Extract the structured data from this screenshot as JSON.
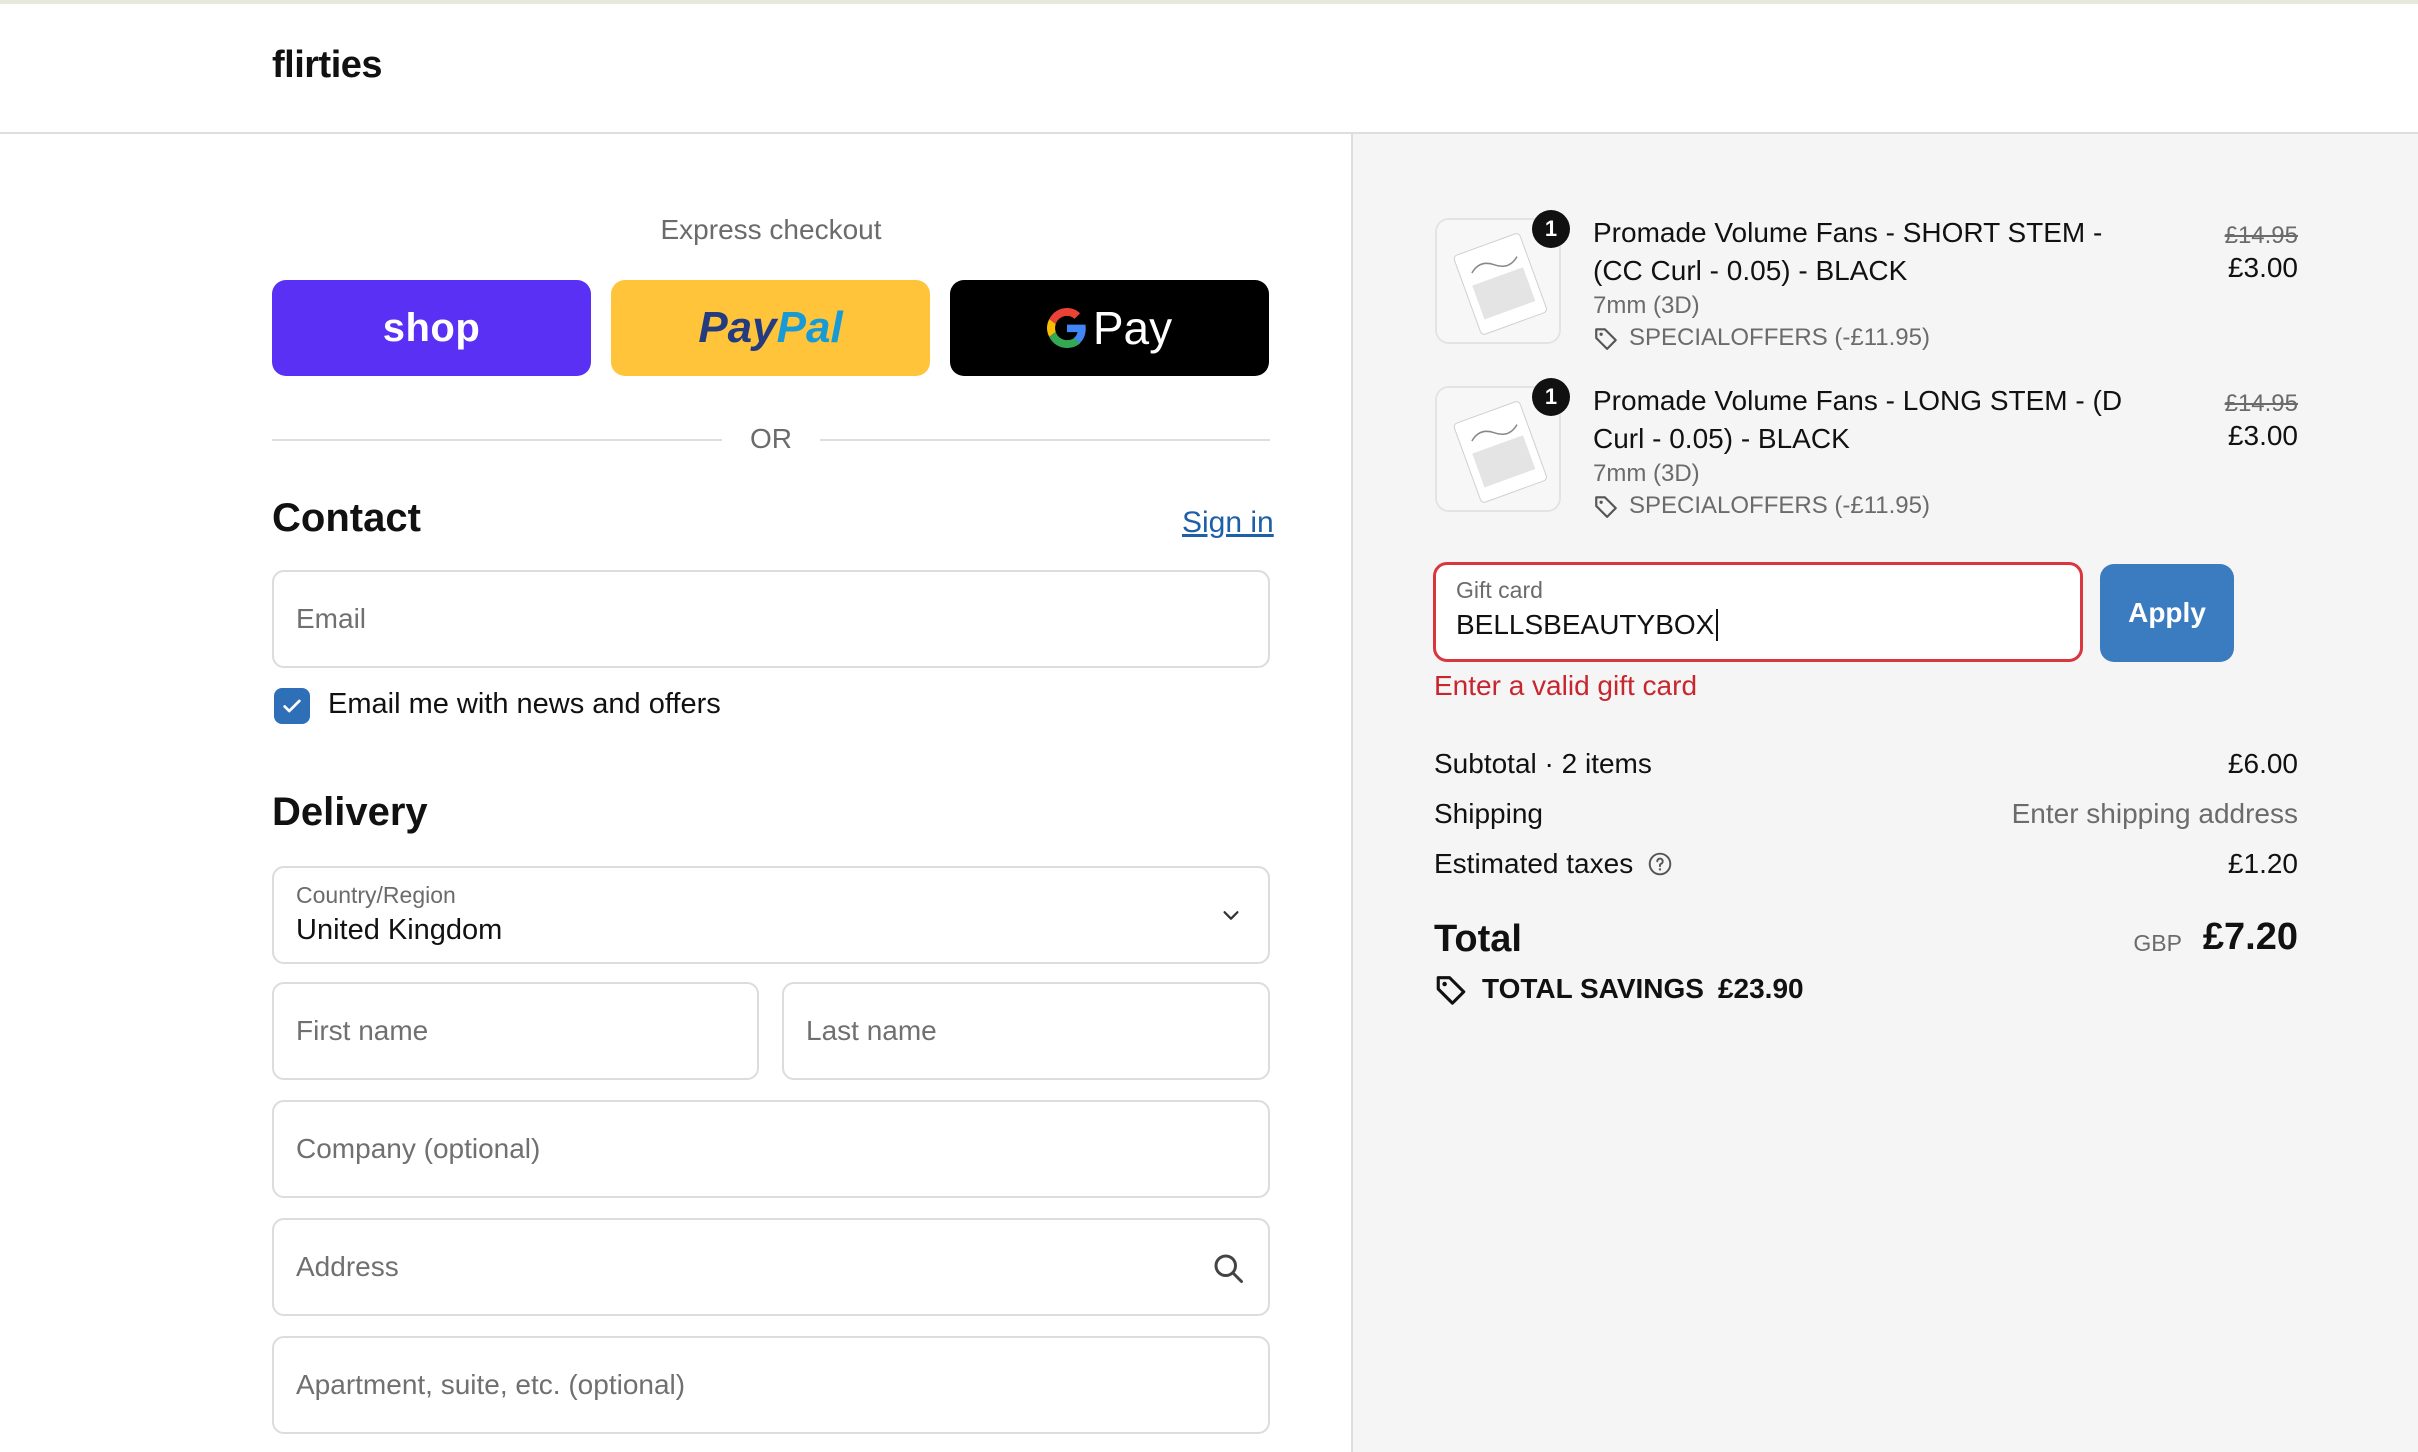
{
  "header": {
    "logo": "flirties"
  },
  "express": {
    "title": "Express checkout",
    "shop_label": "shop",
    "paypal_pay": "Pay",
    "paypal_pal": "Pal",
    "gpay_label": "Pay",
    "or_label": "OR"
  },
  "contact": {
    "heading": "Contact",
    "sign_in": "Sign in",
    "email_placeholder": "Email",
    "news_label": "Email me with news and offers"
  },
  "delivery": {
    "heading": "Delivery",
    "country_label": "Country/Region",
    "country_value": "United Kingdom",
    "first_name_placeholder": "First name",
    "last_name_placeholder": "Last name",
    "company_placeholder": "Company (optional)",
    "address_placeholder": "Address",
    "apartment_placeholder": "Apartment, suite, etc. (optional)"
  },
  "cart": {
    "items": [
      {
        "qty": "1",
        "title": "Promade Volume Fans - SHORT STEM - (CC Curl - 0.05) - BLACK",
        "variant": "7mm (3D)",
        "discount": "SPECIALOFFERS (-£11.95)",
        "price_old": "£14.95",
        "price_new": "£3.00"
      },
      {
        "qty": "1",
        "title": "Promade Volume Fans - LONG STEM - (D Curl - 0.05) - BLACK",
        "variant": "7mm (3D)",
        "discount": "SPECIALOFFERS (-£11.95)",
        "price_old": "£14.95",
        "price_new": "£3.00"
      }
    ]
  },
  "gift": {
    "label": "Gift card",
    "value": "BELLSBEAUTYBOX",
    "apply_label": "Apply",
    "error": "Enter a valid gift card"
  },
  "summary": {
    "subtotal_label": "Subtotal · 2 items",
    "subtotal_value": "£6.00",
    "shipping_label": "Shipping",
    "shipping_value": "Enter shipping address",
    "taxes_label": "Estimated taxes",
    "taxes_value": "£1.20",
    "total_label": "Total",
    "total_currency": "GBP",
    "total_value": "£7.20",
    "savings_label": "TOTAL SAVINGS",
    "savings_value": "£23.90"
  },
  "colors": {
    "shop_purple": "#5a31f4",
    "paypal_yellow": "#ffc43a",
    "link_blue": "#1f5fa8",
    "apply_blue": "#3b7bbf",
    "error_red": "#c8262e"
  }
}
